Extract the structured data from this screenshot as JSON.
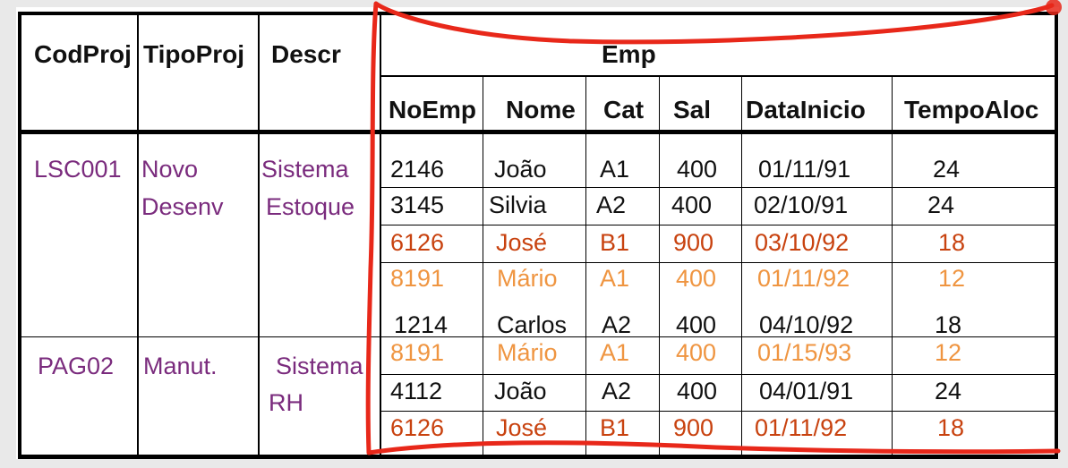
{
  "table": {
    "headers": {
      "codproj": "CodProj",
      "tipoproj": "TipoProj",
      "descr": "Descr",
      "emp": "Emp",
      "sub": [
        "NoEmp",
        "Nome",
        "Cat",
        "Sal",
        "DataInicio",
        "TempoAloc"
      ]
    },
    "projects": [
      {
        "codproj": "LSC001",
        "tipo_line1": "Novo",
        "tipo_line2": "Desenv",
        "descr_line1": "Sistema",
        "descr_line2": "Estoque"
      },
      {
        "codproj": "PAG02",
        "tipo_line1": "Manut.",
        "tipo_line2": "",
        "descr_line1": "Sistema",
        "descr_line2": "RH"
      }
    ],
    "rows": [
      {
        "noemp": "2146",
        "nome": "João",
        "cat": "A1",
        "sal": "400",
        "data": "01/11/91",
        "tempo": "24",
        "color": "black"
      },
      {
        "noemp": "3145",
        "nome": "Silvia",
        "cat": "A2",
        "sal": "400",
        "data": "02/10/91",
        "tempo": "24",
        "color": "black"
      },
      {
        "noemp": "6126",
        "nome": "José",
        "cat": "B1",
        "sal": "900",
        "data": "03/10/92",
        "tempo": "18",
        "color": "red"
      },
      {
        "noemp": "8191",
        "nome": "Mário",
        "cat": "A1",
        "sal": "400",
        "data": "01/11/92",
        "tempo": "12",
        "color": "orange"
      },
      {
        "noemp": "1214",
        "nome": "Carlos",
        "cat": "A2",
        "sal": "400",
        "data": "04/10/92",
        "tempo": "18",
        "color": "black"
      },
      {
        "noemp": "8191",
        "nome": "Mário",
        "cat": "A1",
        "sal": "400",
        "data": "01/15/93",
        "tempo": "12",
        "color": "orange"
      },
      {
        "noemp": "4112",
        "nome": "João",
        "cat": "A2",
        "sal": "400",
        "data": "04/01/91",
        "tempo": "24",
        "color": "black"
      },
      {
        "noemp": "6126",
        "nome": "José",
        "cat": "B1",
        "sal": "900",
        "data": "01/11/92",
        "tempo": "18",
        "color": "red"
      }
    ]
  },
  "colors": {
    "project_text": "#7a2b7d",
    "row_black": "#111111",
    "row_red": "#c8420f",
    "row_orange": "#ef9541",
    "annotation_marker": "#e8281a"
  }
}
